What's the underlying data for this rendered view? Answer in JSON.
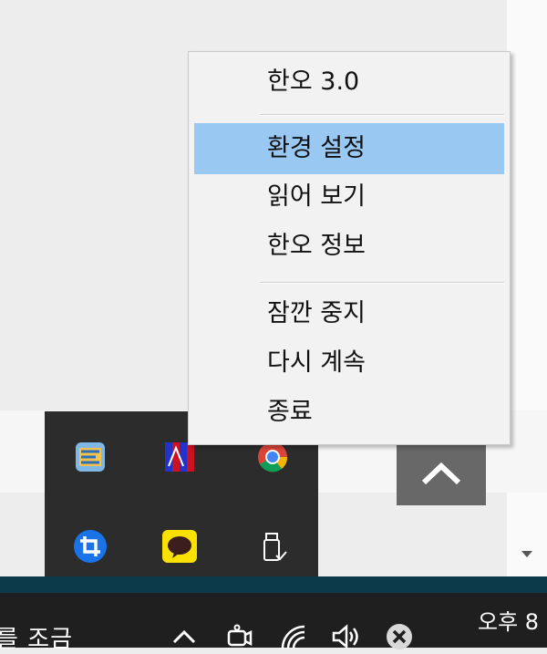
{
  "context_menu": {
    "items": [
      {
        "label": "한오 3.0"
      },
      {
        "label": "환경 설정"
      },
      {
        "label": "읽어 보기"
      },
      {
        "label": "한오 정보"
      },
      {
        "label": "잠깐 중지"
      },
      {
        "label": "다시 계속"
      },
      {
        "label": "종료"
      }
    ],
    "highlight_color": "#99c9f3"
  },
  "tray_popup": {
    "icons": [
      "hanoh-app-icon",
      "striped-flag-icon",
      "chrome-icon",
      "crop-tool-icon",
      "kakaotalk-icon",
      "usb-drive-icon"
    ]
  },
  "taskbar": {
    "partial_text": "를 조금",
    "clock": "오후 8",
    "icons": [
      "chevron-up-icon",
      "meet-now-icon",
      "wifi-icon",
      "speaker-icon",
      "close-circle-icon"
    ]
  },
  "colors": {
    "taskbar_bg": "#1f1f1f",
    "tray_bg": "#2c2c2c"
  }
}
